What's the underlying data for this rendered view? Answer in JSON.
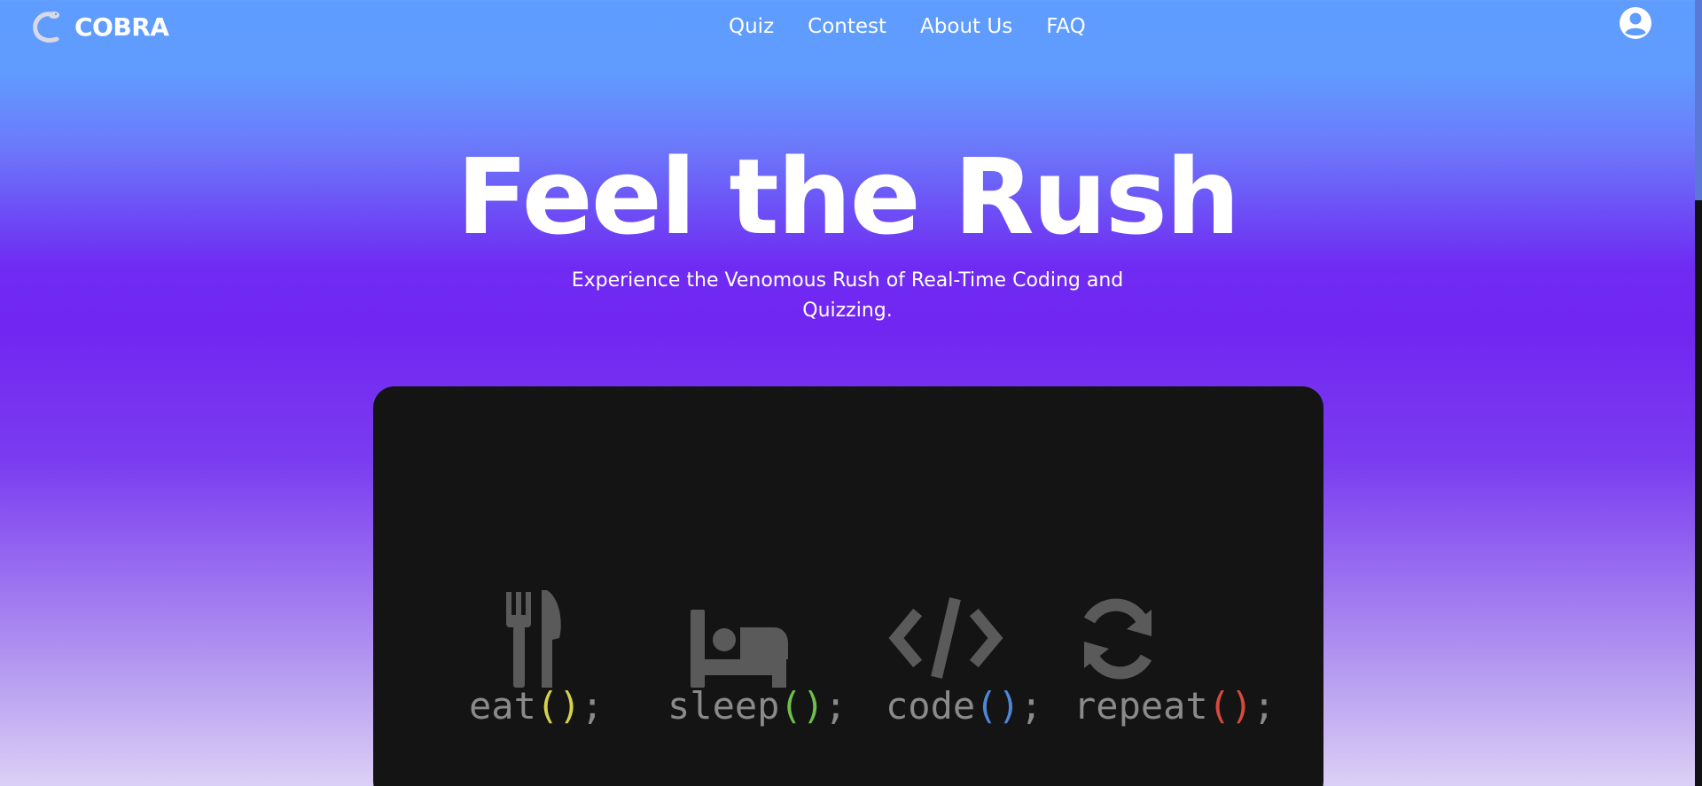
{
  "brand": {
    "name": "COBRA",
    "logo_icon": "cobra-snake-icon"
  },
  "nav": {
    "items": [
      {
        "label": "Quiz"
      },
      {
        "label": "Contest"
      },
      {
        "label": "About Us"
      },
      {
        "label": "FAQ"
      }
    ],
    "account_icon": "user-circle-icon"
  },
  "hero": {
    "title": "Feel the Rush",
    "subtitle": "Experience the Venomous Rush of Real-Time Coding and Quizzing."
  },
  "media": {
    "motto": [
      {
        "icon": "fork-knife-icon",
        "word": "eat",
        "paren_open": "(",
        "paren_close": ")",
        "semicolon": ";",
        "paren_color": "#d6d14a"
      },
      {
        "icon": "bed-icon",
        "word": "sleep",
        "paren_open": "(",
        "paren_close": ")",
        "semicolon": ";",
        "paren_color": "#6fbf4a"
      },
      {
        "icon": "code-brackets-icon",
        "word": "code",
        "paren_open": "(",
        "paren_close": ")",
        "semicolon": ";",
        "paren_color": "#4f86d6"
      },
      {
        "icon": "refresh-icon",
        "word": "repeat",
        "paren_open": "(",
        "paren_close": ")",
        "semicolon": ";",
        "paren_color": "#d64a3e"
      }
    ]
  },
  "colors": {
    "gradient_top": "#5e9cff",
    "gradient_mid": "#7226f1",
    "gradient_bottom": "#dcd0f5",
    "card_background": "#141414",
    "motto_text": "#8a8a8a"
  }
}
